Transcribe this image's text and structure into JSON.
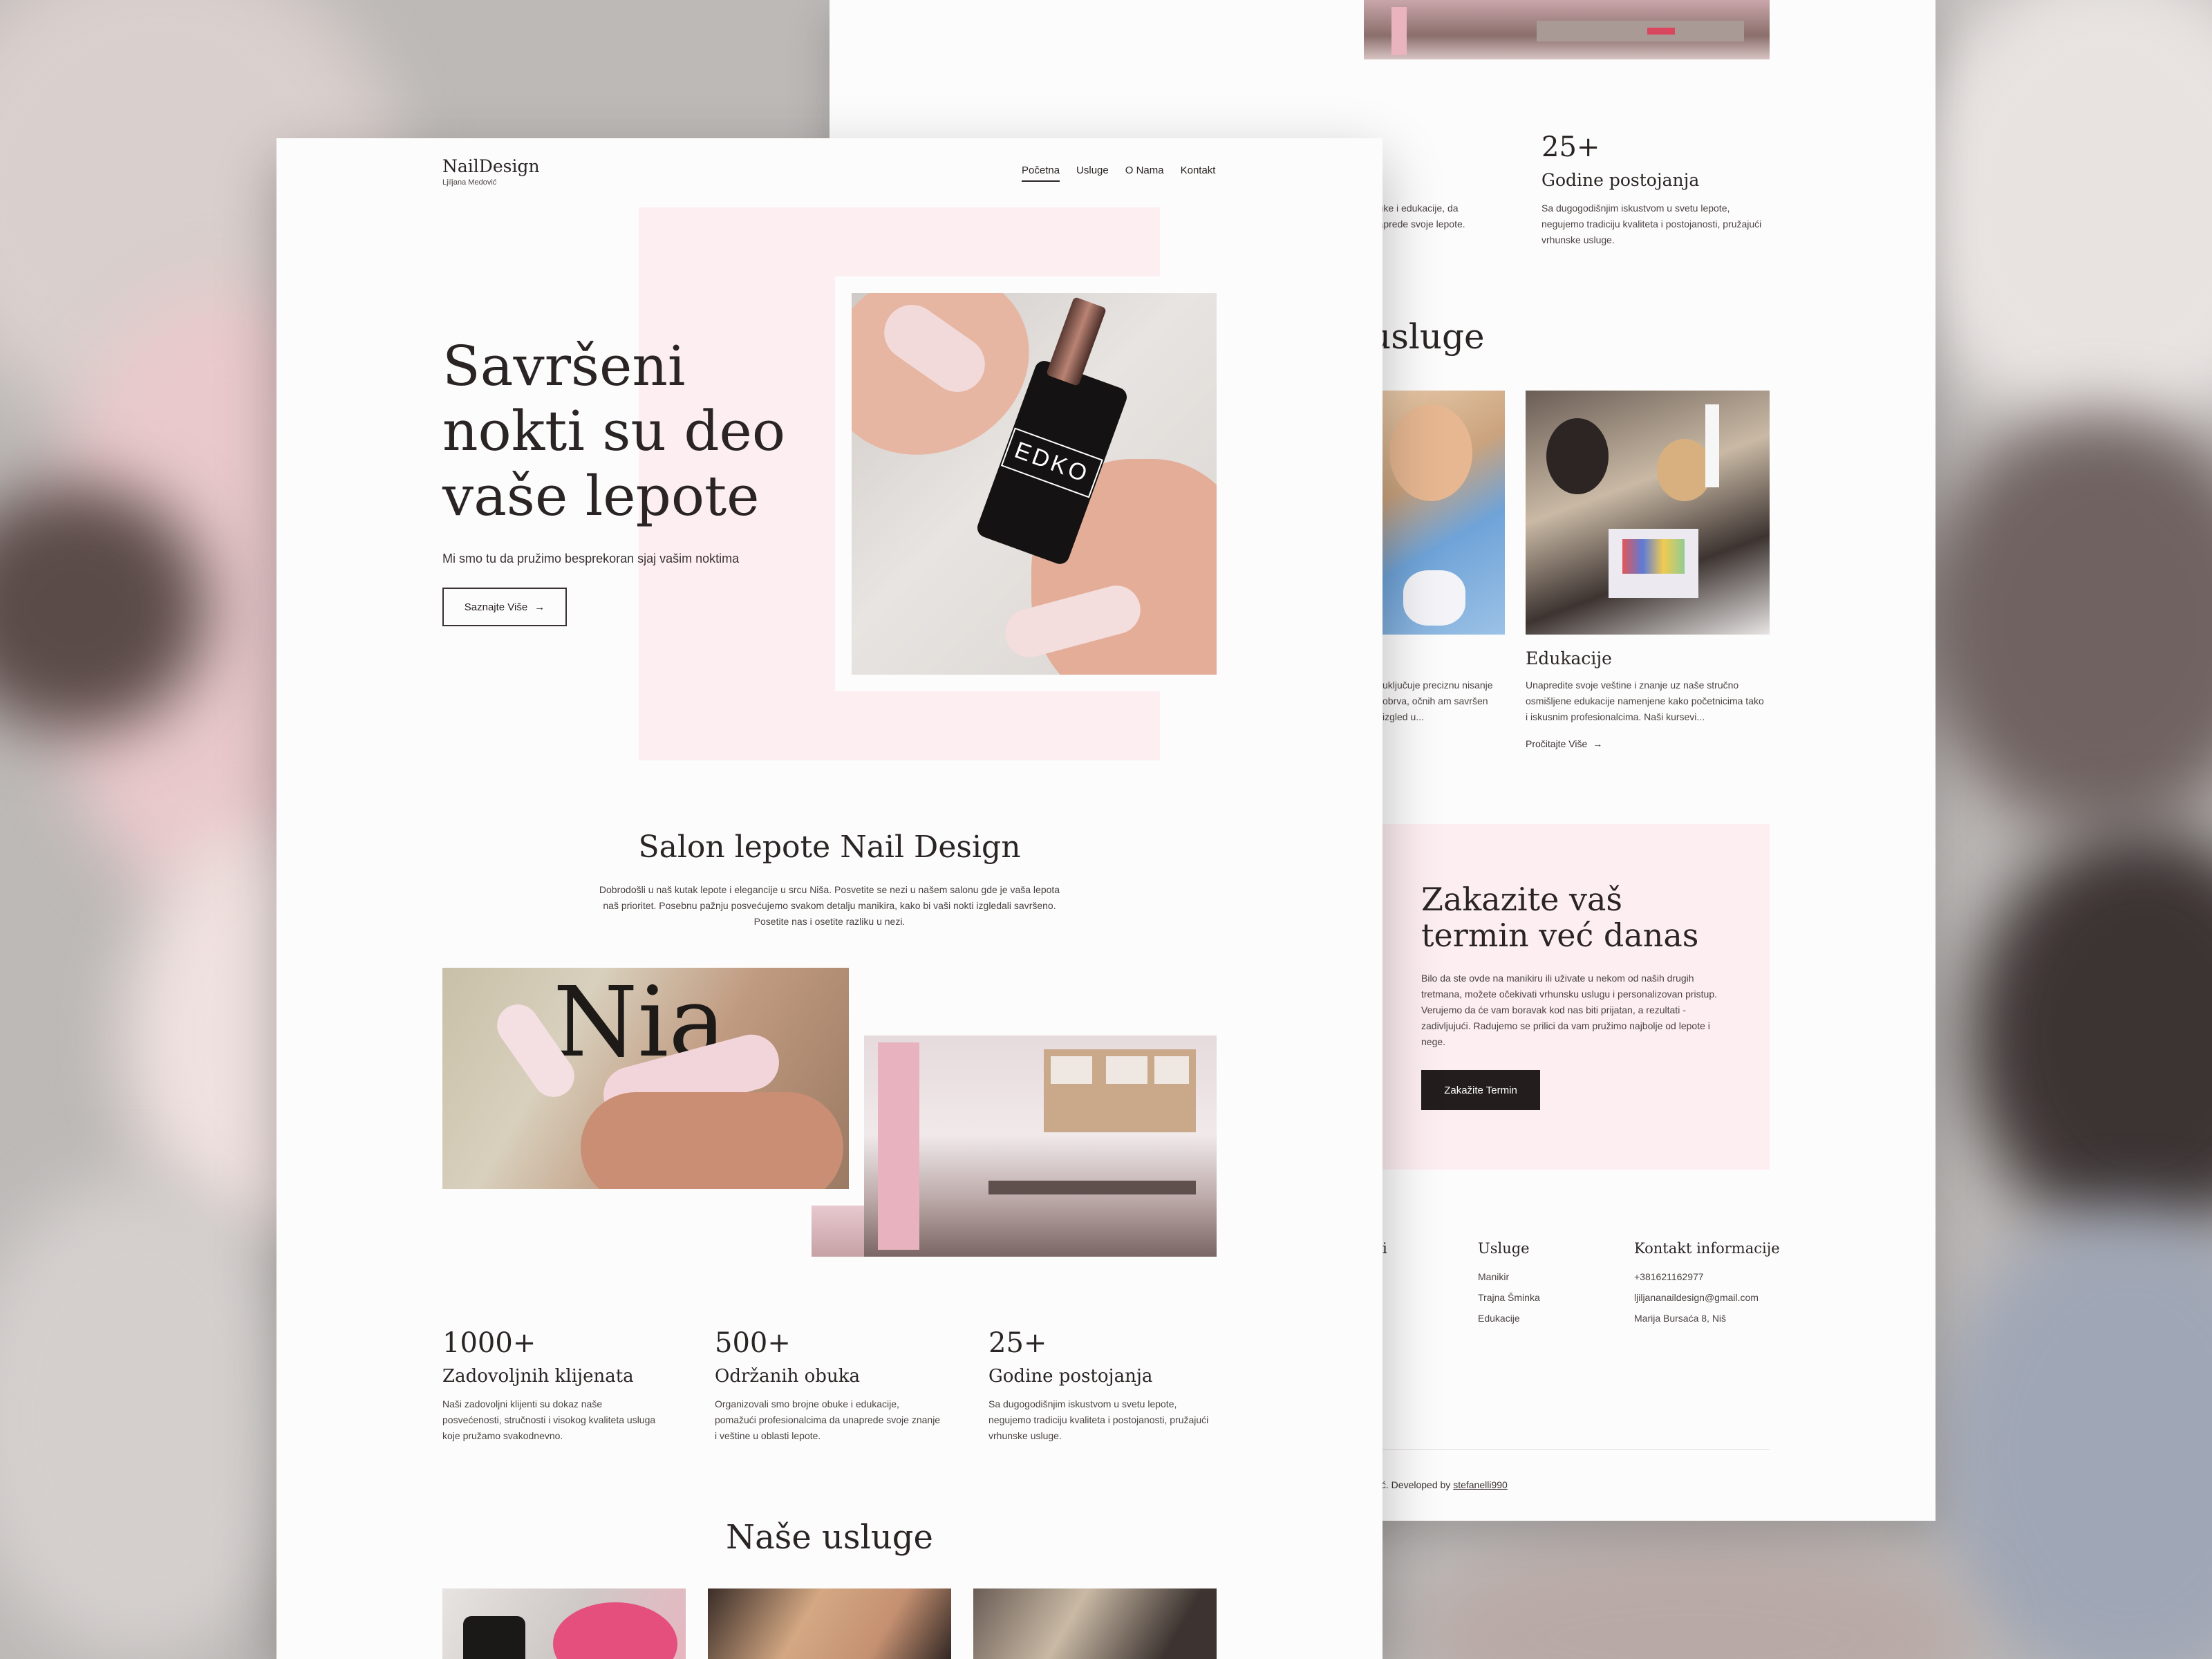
{
  "brand": {
    "name": "NailDesign",
    "subtitle": "Ljiljana Medović"
  },
  "nav": {
    "items": [
      "Početna",
      "Usluge",
      "O Nama",
      "Kontakt"
    ],
    "active": "Početna"
  },
  "hero": {
    "title_l1": "Savršeni",
    "title_l2": "nokti su deo",
    "title_l3": "vaše lepote",
    "subtitle": "Mi smo tu da pružimo besprekoran sjaj vašim noktima",
    "cta": "Saznajte Više",
    "product_text": "EDKO"
  },
  "about": {
    "title": "Salon lepote Nail Design",
    "text": "Dobrodošli u naš kutak lepote i elegancije u srcu Niša. Posvetite se nezi u našem salonu gde je vaša lepota naš prioritet. Posebnu pažnju posvećujemo svakom detalju manikira, kako bi vaši nokti izgledali savršeno. Posetite nas i osetite razliku u nezi."
  },
  "stats": [
    {
      "num": "1000+",
      "label": "Zadovoljnih klijenata",
      "text": "Naši zadovoljni klijenti su dokaz naše posvećenosti, stručnosti i visokog kvaliteta usluga koje pružamo svakodnevno."
    },
    {
      "num": "500+",
      "label": "Održanih obuka",
      "text": "Organizovali smo brojne obuke i edukacije, pomažući profesionalcima da unaprede svoje znanje i veštine u oblasti lepote."
    },
    {
      "num": "25+",
      "label": "Godine postojanja",
      "text": "Sa dugogodišnjim iskustvom u svetu lepote, negujemo tradiciju kvaliteta i postojanosti, pružajući vrhunske usluge."
    }
  ],
  "services": {
    "title": "Naše usluge",
    "title_partial": "usluge"
  },
  "back": {
    "stat_partial_label": "a",
    "stat_partial_text": "obuke i edukacije, da unaprede svoje lepote.",
    "service_partial_text": "uključuje preciznu nisanje obrva, očnih am savršen izgled u...",
    "edu_title": "Edukacije",
    "edu_text": "Unapredite svoje veštine i znanje uz naše stručno osmišljene edukacije namenjene kako početnicima tako i iskusnim profesionalcima. Naši kursevi...",
    "read_more": "Pročitajte Više"
  },
  "booking": {
    "title_l1": "Zakazite vaš",
    "title_l2": "termin već danas",
    "text": "Bilo da ste ovde na manikiru ili uživate u nekom od naših drugih tretmana, možete očekivati vrhunsku uslugu i personalizovan pristup. Verujemo da će vam boravak kod nas biti prijatan, a rezultati - zadivljujući. Radujemo se prilici da vam pružimo najbolje od lepote i nege.",
    "cta": "Zakažite Termin"
  },
  "footer": {
    "partial_col": "i",
    "services_title": "Usluge",
    "services": [
      "Manikir",
      "Trajna Šminka",
      "Edukacije"
    ],
    "contact_title": "Kontakt informacije",
    "contact": [
      "+381621162977",
      "ljiljananaildesign@gmail.com",
      "Marija Bursaća 8, Niš"
    ],
    "credit_prefix": "ović. Developed by ",
    "credit_link": "stefanelli990"
  },
  "colors": {
    "accent_pink": "#fdeef1",
    "dark": "#231d1d",
    "text": "#2a2424"
  }
}
